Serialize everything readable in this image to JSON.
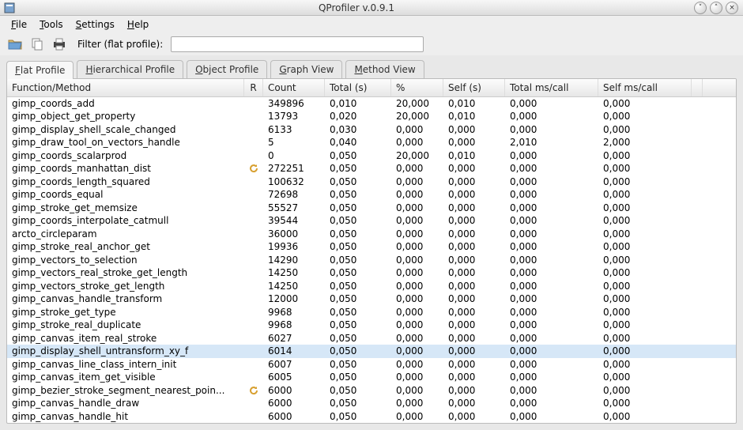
{
  "window": {
    "title": "QProfiler v.0.9.1"
  },
  "menu": {
    "file": "File",
    "tools": "Tools",
    "settings": "Settings",
    "help": "Help"
  },
  "toolbar": {
    "filter_label": "Filter (flat profile):",
    "filter_value": ""
  },
  "tabs": {
    "flat": "Flat Profile",
    "hierarchical": "Hierarchical Profile",
    "object": "Object Profile",
    "graph": "Graph View",
    "method": "Method View"
  },
  "columns": {
    "fn": "Function/Method",
    "r": "R",
    "count": "Count",
    "total": "Total (s)",
    "pct": "%",
    "self": "Self (s)",
    "total_ms": "Total ms/call",
    "self_ms": "Self ms/call"
  },
  "selected_index": 19,
  "rows": [
    {
      "fn": "gimp_coords_add",
      "r": "",
      "count": "349896",
      "total": "0,010",
      "pct": "20,000",
      "self": "0,010",
      "tmc": "0,000",
      "smc": "0,000"
    },
    {
      "fn": "gimp_object_get_property",
      "r": "",
      "count": "13793",
      "total": "0,020",
      "pct": "20,000",
      "self": "0,010",
      "tmc": "0,000",
      "smc": "0,000"
    },
    {
      "fn": "gimp_display_shell_scale_changed",
      "r": "",
      "count": "6133",
      "total": "0,030",
      "pct": "0,000",
      "self": "0,000",
      "tmc": "0,000",
      "smc": "0,000"
    },
    {
      "fn": "gimp_draw_tool_on_vectors_handle",
      "r": "",
      "count": "5",
      "total": "0,040",
      "pct": "0,000",
      "self": "0,000",
      "tmc": "2,010",
      "smc": "2,000"
    },
    {
      "fn": "gimp_coords_scalarprod",
      "r": "",
      "count": "0",
      "total": "0,050",
      "pct": "20,000",
      "self": "0,010",
      "tmc": "0,000",
      "smc": "0,000"
    },
    {
      "fn": "gimp_coords_manhattan_dist",
      "r": "recurse",
      "count": "272251",
      "total": "0,050",
      "pct": "0,000",
      "self": "0,000",
      "tmc": "0,000",
      "smc": "0,000"
    },
    {
      "fn": "gimp_coords_length_squared",
      "r": "",
      "count": "100632",
      "total": "0,050",
      "pct": "0,000",
      "self": "0,000",
      "tmc": "0,000",
      "smc": "0,000"
    },
    {
      "fn": "gimp_coords_equal",
      "r": "",
      "count": "72698",
      "total": "0,050",
      "pct": "0,000",
      "self": "0,000",
      "tmc": "0,000",
      "smc": "0,000"
    },
    {
      "fn": "gimp_stroke_get_memsize",
      "r": "",
      "count": "55527",
      "total": "0,050",
      "pct": "0,000",
      "self": "0,000",
      "tmc": "0,000",
      "smc": "0,000"
    },
    {
      "fn": "gimp_coords_interpolate_catmull",
      "r": "",
      "count": "39544",
      "total": "0,050",
      "pct": "0,000",
      "self": "0,000",
      "tmc": "0,000",
      "smc": "0,000"
    },
    {
      "fn": "arcto_circleparam",
      "r": "",
      "count": "36000",
      "total": "0,050",
      "pct": "0,000",
      "self": "0,000",
      "tmc": "0,000",
      "smc": "0,000"
    },
    {
      "fn": "gimp_stroke_real_anchor_get",
      "r": "",
      "count": "19936",
      "total": "0,050",
      "pct": "0,000",
      "self": "0,000",
      "tmc": "0,000",
      "smc": "0,000"
    },
    {
      "fn": "gimp_vectors_to_selection",
      "r": "",
      "count": "14290",
      "total": "0,050",
      "pct": "0,000",
      "self": "0,000",
      "tmc": "0,000",
      "smc": "0,000"
    },
    {
      "fn": "gimp_vectors_real_stroke_get_length",
      "r": "",
      "count": "14250",
      "total": "0,050",
      "pct": "0,000",
      "self": "0,000",
      "tmc": "0,000",
      "smc": "0,000"
    },
    {
      "fn": "gimp_vectors_stroke_get_length",
      "r": "",
      "count": "14250",
      "total": "0,050",
      "pct": "0,000",
      "self": "0,000",
      "tmc": "0,000",
      "smc": "0,000"
    },
    {
      "fn": "gimp_canvas_handle_transform",
      "r": "",
      "count": "12000",
      "total": "0,050",
      "pct": "0,000",
      "self": "0,000",
      "tmc": "0,000",
      "smc": "0,000"
    },
    {
      "fn": "gimp_stroke_get_type",
      "r": "",
      "count": "9968",
      "total": "0,050",
      "pct": "0,000",
      "self": "0,000",
      "tmc": "0,000",
      "smc": "0,000"
    },
    {
      "fn": "gimp_stroke_real_duplicate",
      "r": "",
      "count": "9968",
      "total": "0,050",
      "pct": "0,000",
      "self": "0,000",
      "tmc": "0,000",
      "smc": "0,000"
    },
    {
      "fn": "gimp_canvas_item_real_stroke",
      "r": "",
      "count": "6027",
      "total": "0,050",
      "pct": "0,000",
      "self": "0,000",
      "tmc": "0,000",
      "smc": "0,000"
    },
    {
      "fn": "gimp_display_shell_untransform_xy_f",
      "r": "",
      "count": "6014",
      "total": "0,050",
      "pct": "0,000",
      "self": "0,000",
      "tmc": "0,000",
      "smc": "0,000"
    },
    {
      "fn": "gimp_canvas_line_class_intern_init",
      "r": "",
      "count": "6007",
      "total": "0,050",
      "pct": "0,000",
      "self": "0,000",
      "tmc": "0,000",
      "smc": "0,000"
    },
    {
      "fn": "gimp_canvas_item_get_visible",
      "r": "",
      "count": "6005",
      "total": "0,050",
      "pct": "0,000",
      "self": "0,000",
      "tmc": "0,000",
      "smc": "0,000"
    },
    {
      "fn": "gimp_bezier_stroke_segment_nearest_poin...",
      "r": "recurse",
      "count": "6000",
      "total": "0,050",
      "pct": "0,000",
      "self": "0,000",
      "tmc": "0,000",
      "smc": "0,000"
    },
    {
      "fn": "gimp_canvas_handle_draw",
      "r": "",
      "count": "6000",
      "total": "0,050",
      "pct": "0,000",
      "self": "0,000",
      "tmc": "0,000",
      "smc": "0,000"
    },
    {
      "fn": "gimp_canvas_handle_hit",
      "r": "",
      "count": "6000",
      "total": "0,050",
      "pct": "0,000",
      "self": "0,000",
      "tmc": "0,000",
      "smc": "0,000"
    }
  ]
}
